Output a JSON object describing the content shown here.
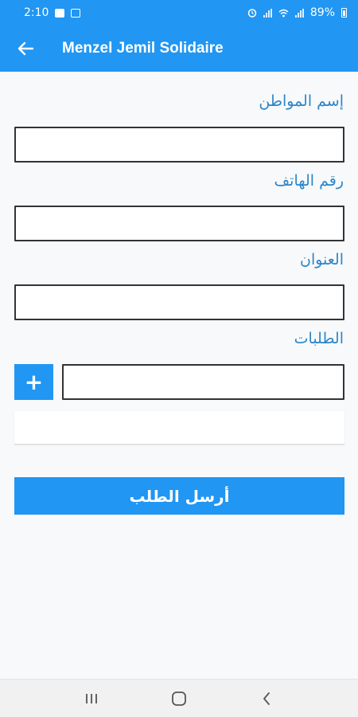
{
  "status_bar": {
    "time": "2:10",
    "battery_percent": "89%"
  },
  "app_bar": {
    "title": "Menzel Jemil Solidaire",
    "back_icon": "arrow-left-icon"
  },
  "form": {
    "citizen_name_label": "إسم المواطن",
    "citizen_name_value": "",
    "phone_label": "رقم الهاتف",
    "phone_value": "",
    "address_label": "العنوان",
    "address_value": "",
    "requests_label": "الطلبات",
    "request_value": "",
    "add_label": "+",
    "submit_label": "أرسل الطلب"
  },
  "nav_bar": {
    "icons": [
      "recent-apps-icon",
      "home-icon",
      "back-icon"
    ]
  },
  "colors": {
    "primary": "#2196f3",
    "label_text": "#2a86c9"
  }
}
